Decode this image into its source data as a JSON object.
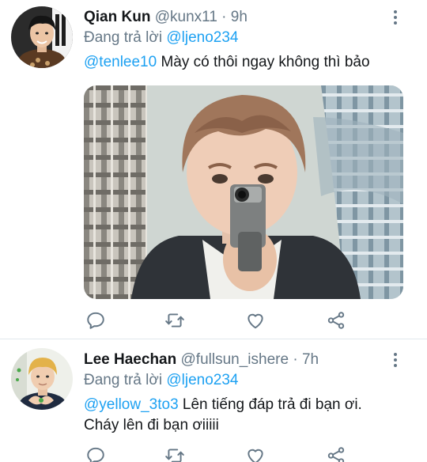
{
  "tweets": [
    {
      "name": "Qian Kun",
      "handle": "@kunx11",
      "separator": "·",
      "time": "9h",
      "replying_prefix": "Đang trả lời",
      "replying_to": "@ljeno234",
      "mention": "@tenlee10",
      "text": " Mày có thôi ngay không thì bảo",
      "has_media": true
    },
    {
      "name": "Lee Haechan",
      "handle": "@fullsun_ishere",
      "separator": "·",
      "time": "7h",
      "replying_prefix": "Đang trả lời",
      "replying_to": "@ljeno234",
      "mention": "@yellow_3to3",
      "text": " Lên tiếng đáp trả đi bạn ơi. Cháy lên đi bạn ơiiiii",
      "has_media": false
    }
  ],
  "icons": {
    "reply": "reply-icon",
    "retweet": "retweet-icon",
    "like": "heart-icon",
    "share": "share-icon",
    "more": "more-vertical-icon"
  },
  "colors": {
    "link": "#1da1f2",
    "secondary_text": "#657786",
    "divider": "#e1e8ed",
    "primary_text": "#14171a"
  }
}
